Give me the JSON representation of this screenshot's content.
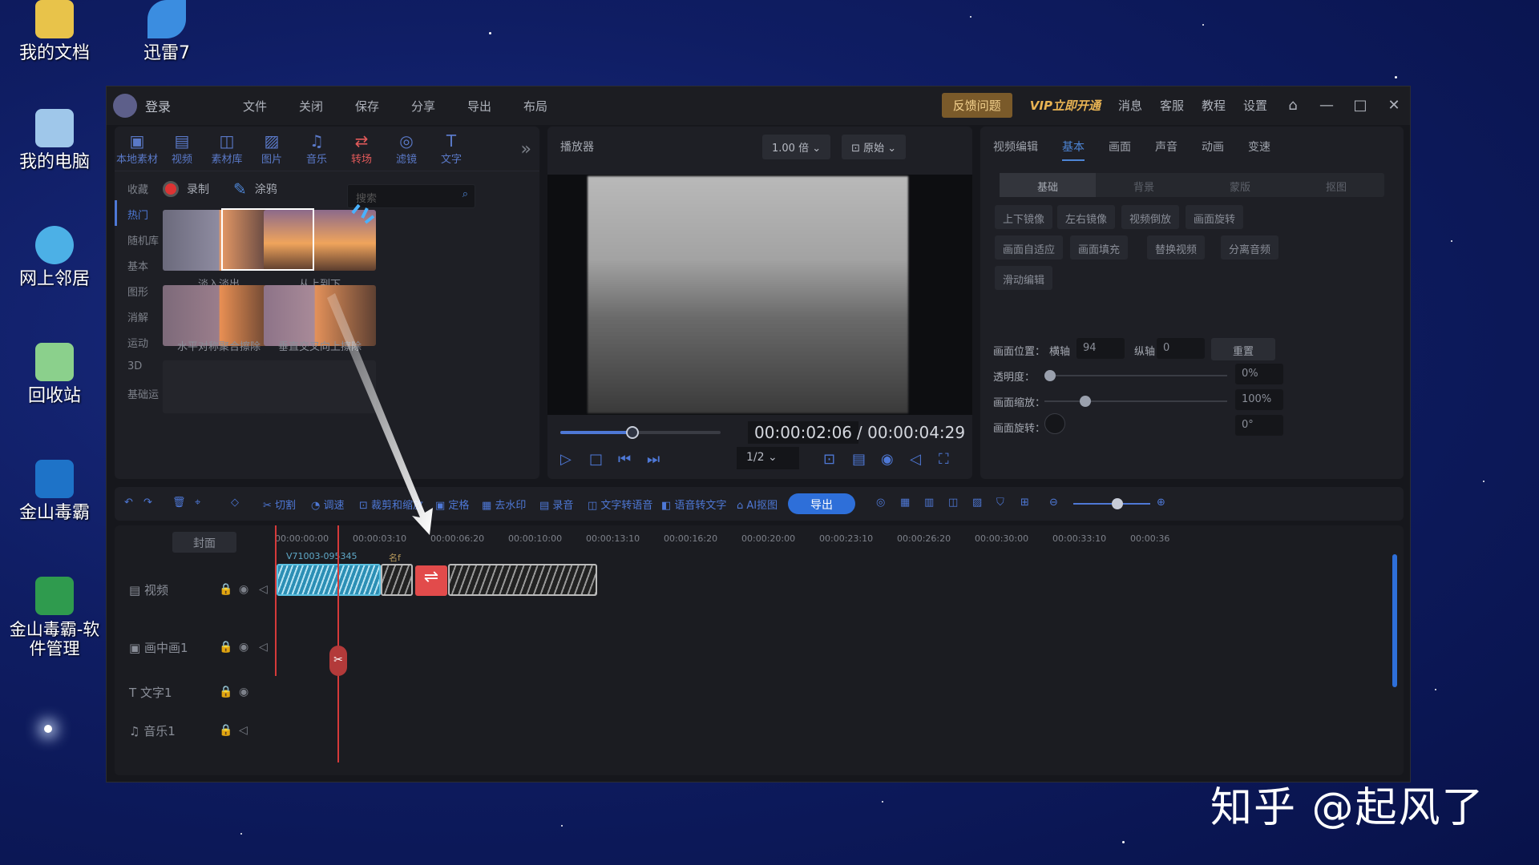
{
  "desktop": {
    "icons": [
      {
        "label": "我的文档"
      },
      {
        "label": "迅雷7"
      },
      {
        "label": "我的电脑"
      },
      {
        "label": "网上邻居"
      },
      {
        "label": "回收站"
      },
      {
        "label": "金山毒霸"
      },
      {
        "label": "金山毒霸-软件管理"
      }
    ]
  },
  "titlebar": {
    "login": "登录",
    "menu": [
      "文件",
      "关闭",
      "保存",
      "分享",
      "导出",
      "布局"
    ],
    "feedback": "反馈问题",
    "vip": "VIP立即开通",
    "links": [
      "消息",
      "客服",
      "教程",
      "设置"
    ]
  },
  "media": {
    "tabs": [
      "本地素材",
      "视频",
      "素材库",
      "图片",
      "音乐",
      "转场",
      "滤镜",
      "文字"
    ],
    "active_tab": "转场",
    "categories": [
      "收藏",
      "热门",
      "随机库",
      "基本",
      "图形",
      "消解",
      "运动",
      "3D",
      "基础运"
    ],
    "record": "录制",
    "graffiti": "涂鸦",
    "search_placeholder": "搜索",
    "items": [
      "淡入淡出",
      "从上到下",
      "水平对称聚合擦除",
      "垂直交叉向上擦除"
    ]
  },
  "player": {
    "title": "播放器",
    "speed": "1.00 倍",
    "mode": "原始",
    "current_time": "00:00:02:06",
    "total_time": "/  00:00:04:29",
    "ratio": "1/2"
  },
  "props": {
    "section": "视频编辑",
    "tabs": [
      "基本",
      "画面",
      "声音",
      "动画",
      "变速"
    ],
    "subtabs": [
      "基础",
      "背景",
      "蒙版",
      "抠图"
    ],
    "buttons": [
      "上下镜像",
      "左右镜像",
      "视频倒放",
      "画面旋转",
      "画面自适应",
      "画面填充",
      "替换视频",
      "分离音频",
      "滑动编辑"
    ],
    "position_label": "画面位置：",
    "x_label": "横轴",
    "x_value": "94",
    "y_label": "纵轴",
    "y_value": "0",
    "reset": "重置",
    "opacity_label": "透明度：",
    "opacity_value": "0%",
    "scale_label": "画面缩放：",
    "scale_value": "100%",
    "rotate_label": "画面旋转：",
    "rotate_value": "0°"
  },
  "timeline": {
    "toolbar": [
      "切割",
      "调速",
      "裁剪和缩放",
      "定格",
      "去水印",
      "录音",
      "文字转语音",
      "语音转文字",
      "AI抠图"
    ],
    "export": "导出",
    "cover": "封面",
    "ruler": [
      "00:00:00:00",
      "00:00:03:10",
      "00:00:06:20",
      "00:00:10:00",
      "00:00:13:10",
      "00:00:16:20",
      "00:00:20:00",
      "00:00:23:10",
      "00:00:26:20",
      "00:00:30:00",
      "00:00:33:10",
      "00:00:36"
    ],
    "tracks": [
      "视频",
      "画中画1",
      "文字1",
      "音乐1"
    ],
    "clip_name": "V71003-095345",
    "clip_name2": "名f"
  },
  "watermark": "知乎 @起风了"
}
